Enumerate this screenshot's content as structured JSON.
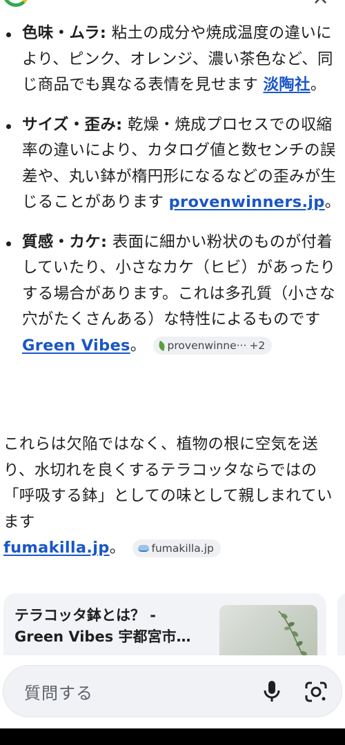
{
  "header": {
    "logo_icon": "google-logo-icon",
    "close_icon": "close-icon"
  },
  "bullets": [
    {
      "term": "色味・ムラ:",
      "text": " 粘土の成分や焼成温度の違いにより、ピンク、オレンジ、濃い茶色など、同じ商品でも異なる表情を見せます ",
      "source": "淡陶社",
      "after": "。"
    },
    {
      "term": "サイズ・歪み:",
      "text": " 乾燥・焼成プロセスでの収縮率の違いにより、カタログ値と数センチの誤差や、丸い鉢が楕円形になるなどの歪みが生じることがあります ",
      "source": "provenwinners.jp",
      "after": "。"
    },
    {
      "term": "質感・カケ:",
      "text": " 表面に細かい粉状のものが付着していたり、小さなカケ（ヒビ）があったりする場合があります。これは多孔質（小さな穴がたくさんある）な特性によるものです ",
      "source": "Green Vibes",
      "after": "。",
      "chip": {
        "label": "provenwinne···",
        "more": "+2",
        "icon": "leaf-icon"
      }
    }
  ],
  "summary": {
    "text": "これらは欠陥ではなく、植物の根に空気を送り、水切れを良くするテラコッタならではの「呼吸する鉢」としての味として親しまれています",
    "source": "fumakilla.jp",
    "after": "。",
    "chip": {
      "label": "fumakilla.jp",
      "icon": "fumakilla-icon"
    }
  },
  "card": {
    "title_line1": "テラコッタ鉢とは？ -",
    "title_line2": "Green Vibes 宇都宮市…"
  },
  "ask": {
    "placeholder": "質問する",
    "mic_icon": "microphone-icon",
    "lens_icon": "google-lens-icon"
  }
}
